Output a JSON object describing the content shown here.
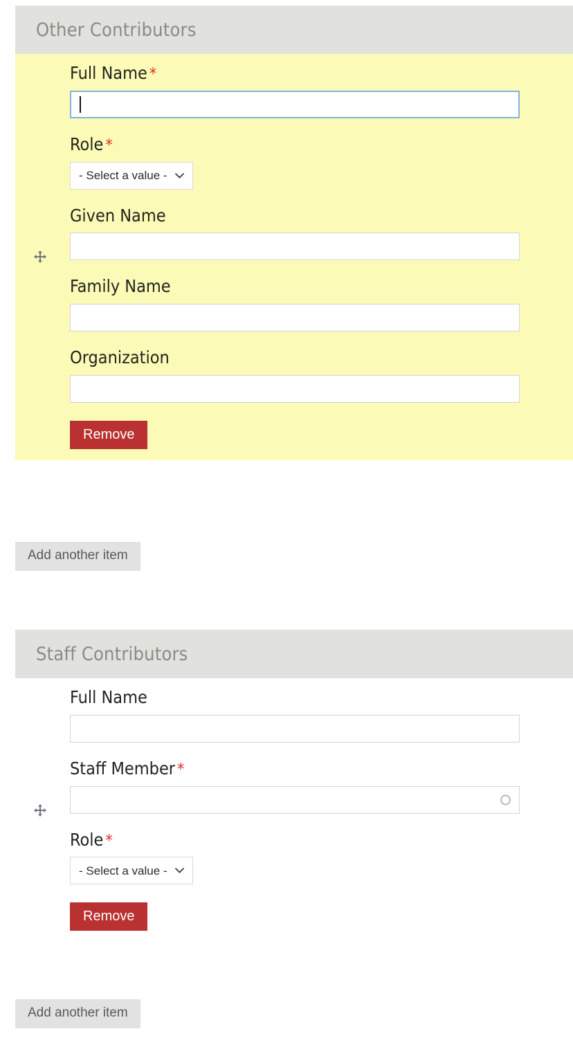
{
  "page": {
    "background": "#ffffff",
    "highlight_color": "#fbfbb7",
    "header_color": "#e1e1dd",
    "remove_color": "#b93131",
    "add_color": "#e2e2e2",
    "required_color": "#e02a2a",
    "focus_border_color": "#81b4de"
  },
  "groups": [
    {
      "title": "Other Contributors",
      "drag_handle_icon": "move-handle-icon",
      "row_highlighted": true,
      "fields": [
        {
          "label": "Full Name",
          "required": true,
          "required_mark": "*",
          "type": "text",
          "value": "",
          "placeholder": "",
          "focused": true
        },
        {
          "label": "Role",
          "required": true,
          "required_mark": "*",
          "type": "select",
          "value": "- Select a value -",
          "options": [
            "- Select a value -"
          ],
          "chevron_icon": "chevron-down-icon"
        },
        {
          "label": "Given Name",
          "required": false,
          "required_mark": "",
          "type": "text",
          "value": "",
          "placeholder": ""
        },
        {
          "label": "Family Name",
          "required": false,
          "required_mark": "",
          "type": "text",
          "value": "",
          "placeholder": ""
        },
        {
          "label": "Organization",
          "required": false,
          "required_mark": "",
          "type": "text",
          "value": "",
          "placeholder": ""
        }
      ],
      "remove_label": "Remove",
      "add_label": "Add another item"
    },
    {
      "title": "Staff Contributors",
      "drag_handle_icon": "move-handle-icon",
      "row_highlighted": false,
      "fields": [
        {
          "label": "Full Name",
          "required": false,
          "required_mark": "",
          "type": "text",
          "value": "",
          "placeholder": ""
        },
        {
          "label": "Staff Member",
          "required": true,
          "required_mark": "*",
          "type": "autocomplete",
          "value": "",
          "placeholder": "",
          "throbber_icon": "autocomplete-throbber-icon"
        },
        {
          "label": "Role",
          "required": true,
          "required_mark": "*",
          "type": "select",
          "value": "- Select a value -",
          "options": [
            "- Select a value -"
          ],
          "chevron_icon": "chevron-down-icon"
        }
      ],
      "remove_label": "Remove",
      "add_label": "Add another item"
    }
  ]
}
